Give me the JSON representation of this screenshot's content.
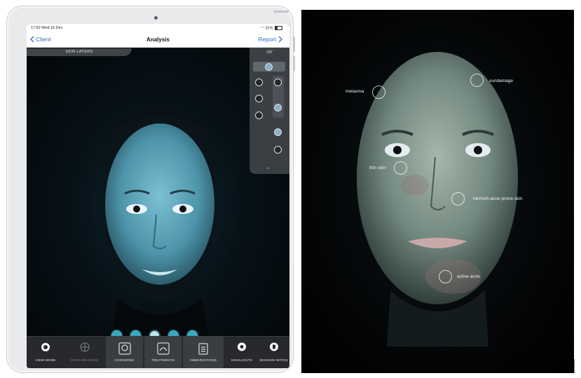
{
  "status_bar": {
    "time": "17:52  Wed 16 Dec",
    "battery": "31%"
  },
  "nav": {
    "back_label": "Client",
    "title": "Analysis",
    "report_label": "Report"
  },
  "skin_layers_tab": "SKIN LAYERS",
  "uv_panel": {
    "label": "UV"
  },
  "toolbar": {
    "items": [
      {
        "label": "VIEW MODE",
        "icon": "face-icon",
        "enabled": true
      },
      {
        "label": "COMPARE MODE",
        "icon": "globe-icon",
        "enabled": false
      },
      {
        "label": "CONCERNS",
        "icon": "concerns-icon",
        "enabled": true
      },
      {
        "label": "TREATMENTS",
        "icon": "treatments-icon",
        "enabled": true
      },
      {
        "label": "OBSERVATIONS",
        "icon": "clipboard-icon",
        "enabled": true
      },
      {
        "label": "HIGHLIGHTS",
        "icon": "highlights-icon",
        "enabled": true
      },
      {
        "label": "SESSION NOTES",
        "icon": "notes-icon",
        "enabled": true
      }
    ]
  },
  "annotations": [
    {
      "label": "melasma"
    },
    {
      "label": "sundamage"
    },
    {
      "label": "thin skin"
    },
    {
      "label": "blemish-acne prone skin"
    },
    {
      "label": "active acne"
    }
  ],
  "colors": {
    "accent": "#2f6fc4",
    "uv_skin": "#6fb3c7",
    "toolbar": "#27292c"
  }
}
